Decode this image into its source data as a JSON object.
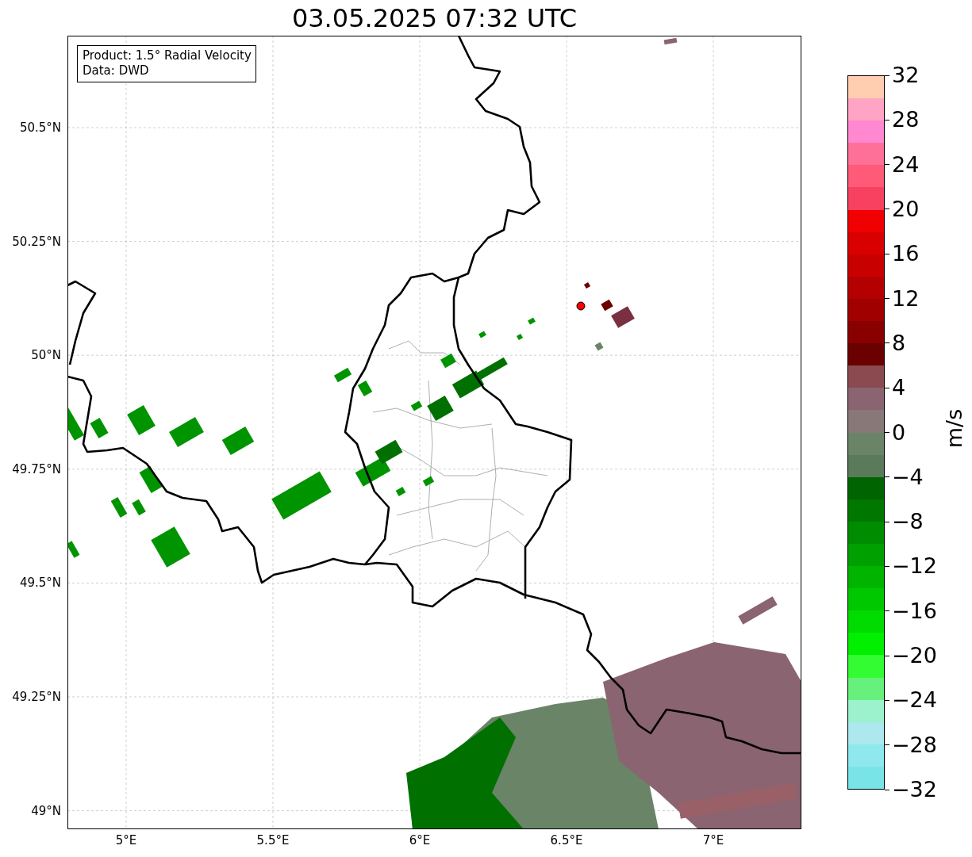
{
  "title": "03.05.2025 07:32 UTC",
  "info_box": {
    "lines": [
      "Product: 1.5° Radial Velocity",
      "Data: DWD"
    ]
  },
  "map": {
    "radar_site": true,
    "x_ticks": [
      "5°E",
      "5.5°E",
      "6°E",
      "6.5°E",
      "7°E"
    ],
    "y_ticks": [
      "50.5°N",
      "50.25°N",
      "50°N",
      "49.75°N",
      "49.5°N",
      "49.25°N",
      "49°N"
    ]
  },
  "colorbar": {
    "label": "m/s",
    "ticks": [
      "32",
      "28",
      "24",
      "20",
      "16",
      "12",
      "8",
      "4",
      "0",
      "−4",
      "−8",
      "−12",
      "−16",
      "−20",
      "−24",
      "−28",
      "−32"
    ],
    "segments": [
      {
        "color": "#ffcdb0"
      },
      {
        "color": "#ffa4c4"
      },
      {
        "color": "#ff88d0"
      },
      {
        "color": "#ff7098"
      },
      {
        "color": "#ff5a78"
      },
      {
        "color": "#f84060"
      },
      {
        "color": "#f00000"
      },
      {
        "color": "#d80000"
      },
      {
        "color": "#c80000"
      },
      {
        "color": "#b40000"
      },
      {
        "color": "#a00000"
      },
      {
        "color": "#880000"
      },
      {
        "color": "#6a0000"
      },
      {
        "color": "#8a4a50"
      },
      {
        "color": "#8a6470"
      },
      {
        "color": "#887878"
      },
      {
        "color": "#6a8468"
      },
      {
        "color": "#5a7a5a"
      },
      {
        "color": "#006400"
      },
      {
        "color": "#007800"
      },
      {
        "color": "#008c00"
      },
      {
        "color": "#00a000"
      },
      {
        "color": "#00b400"
      },
      {
        "color": "#00c800"
      },
      {
        "color": "#00dc00"
      },
      {
        "color": "#00f000"
      },
      {
        "color": "#33fc33"
      },
      {
        "color": "#66f07c"
      },
      {
        "color": "#9cf2cc"
      },
      {
        "color": "#ace8ee"
      },
      {
        "color": "#8ee8ec"
      },
      {
        "color": "#78e4e8"
      }
    ]
  }
}
